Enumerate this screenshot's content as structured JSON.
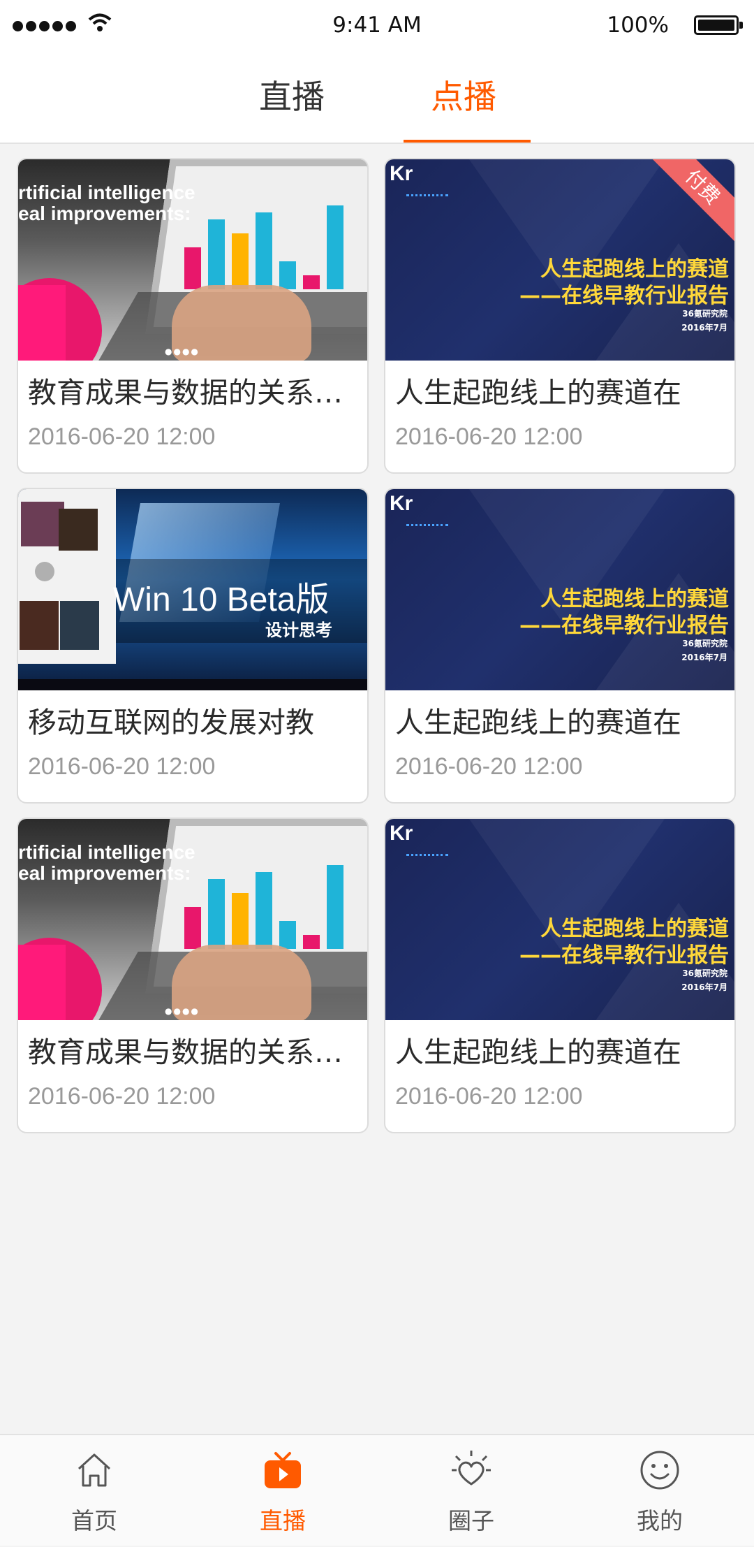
{
  "status_bar": {
    "time": "9:41 AM",
    "battery": "100%"
  },
  "tabs": [
    {
      "label": "直播",
      "active": false
    },
    {
      "label": "点播",
      "active": true
    }
  ],
  "accent_color": "#ff5a00",
  "videos": [
    {
      "title": "教育成果与数据的关系分析",
      "date": "2016-06-20 12:00",
      "thumb": "ai",
      "thumb_text": [
        "rtificial intelligence",
        "eal improvements:"
      ],
      "paid": false
    },
    {
      "title": "人生起跑线上的赛道在",
      "date": "2016-06-20 12:00",
      "thumb": "36kr",
      "thumb_text": [
        "人生起跑线上的赛道",
        "——在线早教行业报告",
        "36氪研究院",
        "2016年7月"
      ],
      "paid": true,
      "badge": "付费"
    },
    {
      "title": "移动互联网的发展对教",
      "date": "2016-06-20 12:00",
      "thumb": "win10",
      "thumb_text": [
        "Win 10 Beta版",
        "设计思考"
      ],
      "paid": false
    },
    {
      "title": "人生起跑线上的赛道在",
      "date": "2016-06-20 12:00",
      "thumb": "36kr",
      "thumb_text": [
        "人生起跑线上的赛道",
        "——在线早教行业报告",
        "36氪研究院",
        "2016年7月"
      ],
      "paid": false
    },
    {
      "title": "教育成果与数据的关系分析",
      "date": "2016-06-20 12:00",
      "thumb": "ai",
      "thumb_text": [
        "rtificial intelligence",
        "eal improvements:"
      ],
      "paid": false
    },
    {
      "title": "人生起跑线上的赛道在",
      "date": "2016-06-20 12:00",
      "thumb": "36kr",
      "thumb_text": [
        "人生起跑线上的赛道",
        "——在线早教行业报告",
        "36氪研究院",
        "2016年7月"
      ],
      "paid": false
    }
  ],
  "bottom_nav": [
    {
      "label": "首页",
      "icon": "home-icon",
      "active": false
    },
    {
      "label": "直播",
      "icon": "tv-icon",
      "active": true
    },
    {
      "label": "圈子",
      "icon": "heart-sun-icon",
      "active": false
    },
    {
      "label": "我的",
      "icon": "smiley-icon",
      "active": false
    }
  ]
}
